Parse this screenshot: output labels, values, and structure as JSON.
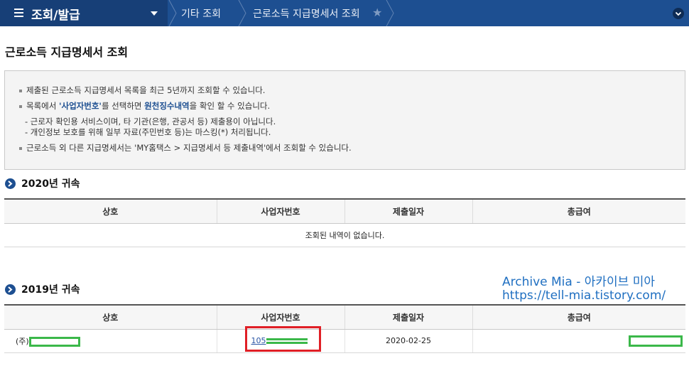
{
  "nav": {
    "menu_label": "조회/발급",
    "breadcrumb": [
      "기타 조회",
      "근로소득 지급명세서 조회"
    ]
  },
  "page": {
    "title": "근로소득 지급명세서 조회"
  },
  "notice": {
    "line1": "제출된 근로소득 지급명세서 목록을 최근 5년까지 조회할 수 있습니다.",
    "line2_a": "목록에서 ",
    "line2_link1": "'사업자번호'",
    "line2_b": "를 선택하면 ",
    "line2_link2": "원천징수내역",
    "line2_c": "을 확인 할 수 있습니다.",
    "sub1": "- 근로자 확인용 서비스이며, 타 기관(은행, 관공서 등) 제출용이 아닙니다.",
    "sub2": "- 개인정보 보호를 위해 일부 자료(주민번호 등)는 마스킹(*) 처리됩니다.",
    "line3": "근로소득 외 다른 지급명세서는 'MY홈택스 > 지급명세서 등 제출내역'에서 조회할 수 있습니다."
  },
  "sections": [
    {
      "heading": "2020년 귀속",
      "columns": [
        "상호",
        "사업자번호",
        "제출일자",
        "총급여"
      ],
      "empty_message": "조회된 내역이 없습니다."
    },
    {
      "heading": "2019년 귀속",
      "columns": [
        "상호",
        "사업자번호",
        "제출일자",
        "총급여"
      ],
      "rows": [
        {
          "company_prefix": "(주)",
          "bizno_prefix": "105",
          "date": "2020-02-25"
        }
      ]
    }
  ],
  "watermark": {
    "line1": "Archive Mia - 아카이브 미아",
    "line2": "https://tell-mia.tistory.com/"
  },
  "colors": {
    "nav_bg": "#1d4f91",
    "highlight_box": "#e01f26",
    "mask": "#3bb84a",
    "watermark": "#1f6fc1"
  },
  "icons": [
    "hamburger-icon",
    "chevron-down-icon",
    "star-icon",
    "expand-icon",
    "arrow-circle-icon"
  ]
}
